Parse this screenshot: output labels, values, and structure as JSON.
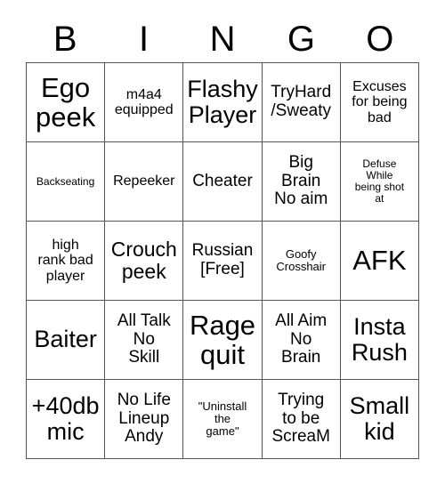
{
  "card": {
    "title": "BINGO",
    "header_letters": [
      "B",
      "I",
      "N",
      "G",
      "O"
    ],
    "grid_size": "5x5",
    "colors": {
      "background": "#ffffff",
      "text": "#000000",
      "grid_line": "#555555"
    },
    "cells": [
      [
        {
          "text": "Ego\npeek",
          "size": "fs-xxl"
        },
        {
          "text": "m4a4\nequipped",
          "size": "fs-sm"
        },
        {
          "text": "Flashy\nPlayer",
          "size": "fs-xl"
        },
        {
          "text": "TryHard\n/Sweaty",
          "size": "fs-md"
        },
        {
          "text": "Excuses\nfor being\nbad",
          "size": "fs-sm"
        }
      ],
      [
        {
          "text": "Backseating",
          "size": "fs-xxs"
        },
        {
          "text": "Repeeker",
          "size": "fs-sm"
        },
        {
          "text": "Cheater",
          "size": "fs-md"
        },
        {
          "text": "Big\nBrain\nNo aim",
          "size": "fs-md"
        },
        {
          "text": "Defuse\nWhile\nbeing shot\nat",
          "size": "fs-xxs"
        }
      ],
      [
        {
          "text": "high\nrank bad\nplayer",
          "size": "fs-sm"
        },
        {
          "text": "Crouch\npeek",
          "size": "fs-lg"
        },
        {
          "text": "Russian\n[Free]",
          "size": "fs-md"
        },
        {
          "text": "Goofy\nCrosshair",
          "size": "fs-xs"
        },
        {
          "text": "AFK",
          "size": "fs-xxl"
        }
      ],
      [
        {
          "text": "Baiter",
          "size": "fs-xl"
        },
        {
          "text": "All Talk\nNo\nSkill",
          "size": "fs-md"
        },
        {
          "text": "Rage\nquit",
          "size": "fs-xxl"
        },
        {
          "text": "All Aim\nNo\nBrain",
          "size": "fs-md"
        },
        {
          "text": "Insta\nRush",
          "size": "fs-xl"
        }
      ],
      [
        {
          "text": "+40db\nmic",
          "size": "fs-xl"
        },
        {
          "text": "No Life\nLineup\nAndy",
          "size": "fs-md"
        },
        {
          "text": "\"Uninstall\nthe\ngame\"",
          "size": "fs-xs"
        },
        {
          "text": "Trying\nto be\nScreaM",
          "size": "fs-md"
        },
        {
          "text": "Small\nkid",
          "size": "fs-xl"
        }
      ]
    ]
  }
}
